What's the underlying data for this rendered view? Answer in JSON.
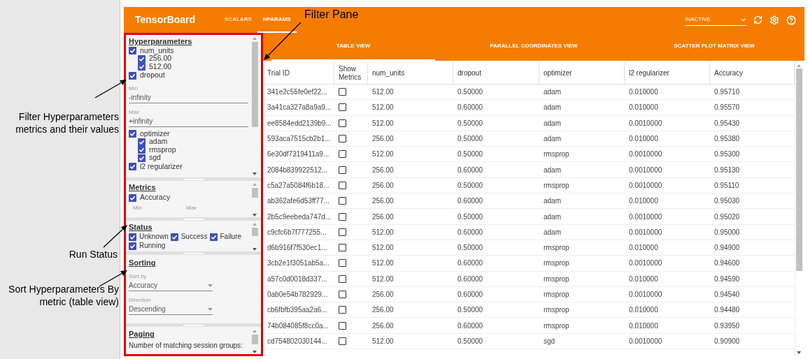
{
  "annotations": [
    {
      "kind": "top",
      "text": "Filter Pane"
    },
    {
      "kind": "filter",
      "text": "Filter Hyperparameters metrics and their values"
    },
    {
      "kind": "status",
      "text": "Run Status"
    },
    {
      "kind": "sort",
      "text": "Sort Hyperparameters By metric (table view)"
    }
  ],
  "header": {
    "brand": "TensorBoard",
    "nav": [
      {
        "label": "SCALARS",
        "selected": false
      },
      {
        "label": "HPARAMS",
        "selected": true
      }
    ],
    "run_select": {
      "value": "INACTIVE"
    }
  },
  "view_tabs": [
    {
      "label": "TABLE VIEW",
      "selected": true
    },
    {
      "label": "PARALLEL COORDINATES VIEW",
      "selected": false
    },
    {
      "label": "SCATTER PLOT MATRIX VIEW",
      "selected": false
    }
  ],
  "filter_pane": {
    "hyperparameters": {
      "title": "Hyperparameters",
      "items": [
        {
          "kind": "discrete",
          "label": "num_units",
          "checked": true,
          "children": [
            {
              "label": "256.00",
              "checked": true
            },
            {
              "label": "512.00",
              "checked": true
            }
          ]
        },
        {
          "kind": "interval",
          "label": "dropout",
          "checked": true,
          "min": {
            "label": "Min",
            "value": "-infinity"
          },
          "max": {
            "label": "Max",
            "value": "+infinity"
          }
        },
        {
          "kind": "discrete",
          "label": "optimizer",
          "checked": true,
          "children": [
            {
              "label": "adam",
              "checked": true
            },
            {
              "label": "rmsprop",
              "checked": true
            },
            {
              "label": "sgd",
              "checked": true
            }
          ]
        },
        {
          "kind": "discrete",
          "label": "l2 regularizer",
          "checked": true
        }
      ]
    },
    "metrics": {
      "title": "Metrics",
      "items": [
        {
          "label": "Accuracy",
          "checked": true
        }
      ],
      "min_label": "Min",
      "max_label": "Max"
    },
    "status": {
      "title": "Status",
      "items": [
        {
          "label": "Unknown",
          "checked": true
        },
        {
          "label": "Success",
          "checked": true
        },
        {
          "label": "Failure",
          "checked": true
        },
        {
          "label": "Running",
          "checked": true
        }
      ]
    },
    "sorting": {
      "title": "Sorting",
      "sort_by": {
        "label": "Sort by",
        "value": "Accuracy"
      },
      "direction": {
        "label": "Direction",
        "value": "Descending"
      }
    },
    "paging": {
      "title": "Paging",
      "text": "Number of matching session groups:"
    }
  },
  "table": {
    "columns": [
      "Trial ID",
      "Show Metrics",
      "num_units",
      "dropout",
      "optimizer",
      "l2 regularizer",
      "Accuracy"
    ],
    "rows": [
      {
        "show_metrics": false,
        "cells": [
          "341e2c55fe0ef22...",
          "",
          "512.00",
          "0.50000",
          "adam",
          "0.010000",
          "0.95710"
        ]
      },
      {
        "show_metrics": false,
        "cells": [
          "3a41ca327a8a9a9...",
          "",
          "512.00",
          "0.60000",
          "adam",
          "0.010000",
          "0.95570"
        ]
      },
      {
        "show_metrics": false,
        "cells": [
          "ee8584edd2139b9...",
          "",
          "512.00",
          "0.50000",
          "adam",
          "0.0010000",
          "0.95430"
        ]
      },
      {
        "show_metrics": false,
        "cells": [
          "593aca7515cb2b1...",
          "",
          "256.00",
          "0.50000",
          "adam",
          "0.010000",
          "0.95380"
        ]
      },
      {
        "show_metrics": false,
        "cells": [
          "6e30df7319411a9...",
          "",
          "512.00",
          "0.50000",
          "rmsprop",
          "0.0010000",
          "0.95300"
        ]
      },
      {
        "show_metrics": false,
        "cells": [
          "2084b839922512...",
          "",
          "256.00",
          "0.60000",
          "adam",
          "0.0010000",
          "0.95130"
        ]
      },
      {
        "show_metrics": false,
        "cells": [
          "c5a27a5084f6b18...",
          "",
          "256.00",
          "0.50000",
          "rmsprop",
          "0.0010000",
          "0.95110"
        ]
      },
      {
        "show_metrics": false,
        "cells": [
          "ab362afe6d53ff77...",
          "",
          "256.00",
          "0.60000",
          "adam",
          "0.010000",
          "0.95030"
        ]
      },
      {
        "show_metrics": false,
        "cells": [
          "2b5c9eebeda747d...",
          "",
          "256.00",
          "0.50000",
          "adam",
          "0.0010000",
          "0.95020"
        ]
      },
      {
        "show_metrics": false,
        "cells": [
          "c9cfc6b7f777255...",
          "",
          "512.00",
          "0.60000",
          "adam",
          "0.0010000",
          "0.95000"
        ]
      },
      {
        "show_metrics": false,
        "cells": [
          "d6b916f7f530ec1...",
          "",
          "512.00",
          "0.50000",
          "rmsprop",
          "0.010000",
          "0.94900"
        ]
      },
      {
        "show_metrics": false,
        "cells": [
          "3cb2e1f3051ab5a...",
          "",
          "512.00",
          "0.60000",
          "rmsprop",
          "0.0010000",
          "0.94600"
        ]
      },
      {
        "show_metrics": false,
        "cells": [
          "a57c0d0018d337...",
          "",
          "512.00",
          "0.60000",
          "rmsprop",
          "0.010000",
          "0.94590"
        ]
      },
      {
        "show_metrics": false,
        "cells": [
          "0ab0e54b782929...",
          "",
          "256.00",
          "0.60000",
          "rmsprop",
          "0.0010000",
          "0.94540"
        ]
      },
      {
        "show_metrics": false,
        "cells": [
          "cb6fbfb395aa2a6...",
          "",
          "256.00",
          "0.50000",
          "rmsprop",
          "0.010000",
          "0.94480"
        ]
      },
      {
        "show_metrics": false,
        "cells": [
          "74b084085f8cc0a...",
          "",
          "256.00",
          "0.60000",
          "rmsprop",
          "0.010000",
          "0.93950"
        ]
      },
      {
        "show_metrics": false,
        "cells": [
          "cd754802030144...",
          "",
          "512.00",
          "0.50000",
          "sgd",
          "0.0010000",
          "0.90900"
        ]
      }
    ]
  }
}
